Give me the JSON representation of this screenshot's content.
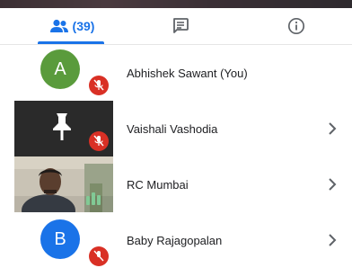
{
  "tabs": {
    "people": {
      "icon": "people-icon",
      "count": "(39)",
      "active": true
    },
    "chat": {
      "icon": "chat-icon"
    },
    "info": {
      "icon": "info-icon"
    }
  },
  "participants": [
    {
      "name": "Abhishek Sawant (You)",
      "avatar_letter": "A",
      "avatar_color": "#5a9b3c",
      "mic_muted": true,
      "has_chevron": false
    },
    {
      "name": "Vaishali Vashodia",
      "avatar_letter": "",
      "tile": "pin-icon",
      "mic_muted": true,
      "has_chevron": true
    },
    {
      "name": "RC Mumbai",
      "avatar_letter": "",
      "tile": "camera-video",
      "speaking": true,
      "has_chevron": true
    },
    {
      "name": "Baby Rajagopalan",
      "avatar_letter": "B",
      "avatar_color": "#1a73e8",
      "mic_muted": true,
      "has_chevron": true
    }
  ],
  "colors": {
    "accent": "#1a73e8",
    "muted_red": "#d93025",
    "speaking_green": "#81c995"
  }
}
